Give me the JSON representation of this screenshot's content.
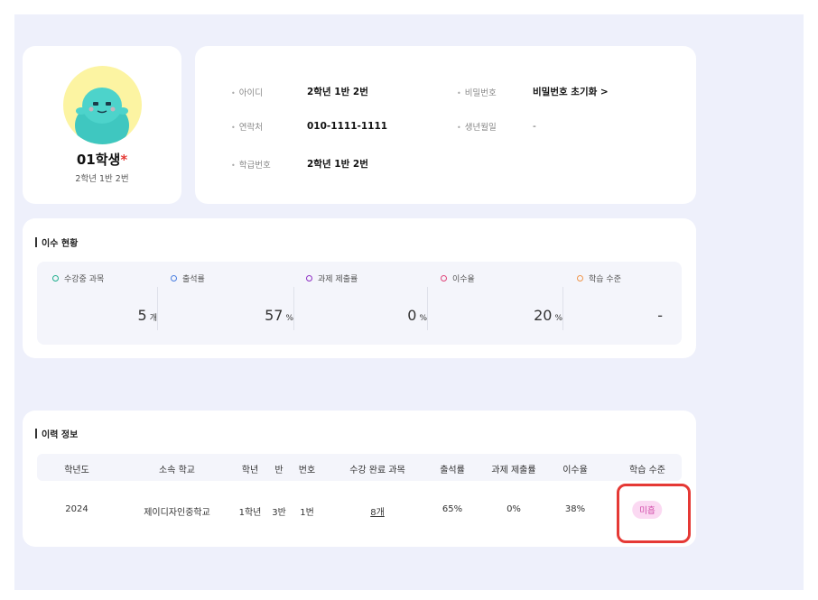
{
  "profile": {
    "name": "01학생",
    "required_mark": "*",
    "class_info": "2학년 1반 2번"
  },
  "info": {
    "id_label": "아이디",
    "id_value": "2학년 1반 2번",
    "password_label": "비밀번호",
    "password_action": "비밀번호 초기화 >",
    "contact_label": "연락처",
    "contact_value": "010-1111-1111",
    "birth_label": "생년월일",
    "birth_value": "-",
    "classnum_label": "학급번호",
    "classnum_value": "2학년 1반 2번"
  },
  "completion": {
    "title": "이수 현황",
    "stats": [
      {
        "label": "수강중 과목",
        "value": "5",
        "unit": "개",
        "color": "#1fae8c"
      },
      {
        "label": "출석률",
        "value": "57",
        "unit": "%",
        "color": "#4a7ee0"
      },
      {
        "label": "과제 제출률",
        "value": "0",
        "unit": "%",
        "color": "#8e2fc4"
      },
      {
        "label": "이수율",
        "value": "20",
        "unit": "%",
        "color": "#e0457a"
      },
      {
        "label": "학습 수준",
        "value": "-",
        "unit": "",
        "color": "#f0954a"
      }
    ]
  },
  "history": {
    "title": "이력 정보",
    "columns": [
      "학년도",
      "소속 학교",
      "학년",
      "반",
      "번호",
      "수강 완료 과목",
      "출석률",
      "과제 제출률",
      "이수율",
      "학습 수준"
    ],
    "rows": [
      [
        "2024",
        "제이디자인중학교",
        "1학년",
        "3반",
        "1번",
        "8개",
        "65%",
        "0%",
        "38%",
        "미흡"
      ]
    ]
  },
  "colors": {
    "page_bg": "#eef0fb",
    "badge_bg": "#fbd9f2",
    "badge_text": "#d04aa8",
    "highlight": "#e53935"
  }
}
